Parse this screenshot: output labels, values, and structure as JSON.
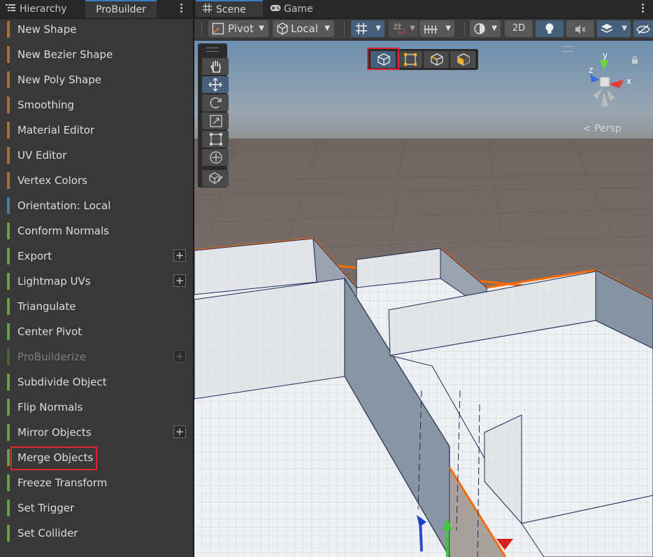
{
  "left_panel": {
    "tabs": [
      {
        "label": "Hierarchy",
        "icon": "hierarchy-icon"
      },
      {
        "label": "ProBuilder"
      }
    ],
    "items": [
      {
        "label": "New Shape",
        "color": "#b06a3b",
        "plus": false,
        "disabled": false
      },
      {
        "label": "New Bezier Shape",
        "color": "#b06a3b",
        "plus": false,
        "disabled": false
      },
      {
        "label": "New Poly Shape",
        "color": "#b06a3b",
        "plus": false,
        "disabled": false
      },
      {
        "label": "Smoothing",
        "color": "#b06a3b",
        "plus": false,
        "disabled": false
      },
      {
        "label": "Material Editor",
        "color": "#b06a3b",
        "plus": false,
        "disabled": false
      },
      {
        "label": "UV Editor",
        "color": "#b06a3b",
        "plus": false,
        "disabled": false
      },
      {
        "label": "Vertex Colors",
        "color": "#b06a3b",
        "plus": false,
        "disabled": false
      },
      {
        "label": "Orientation: Local",
        "color": "#3c7fb5",
        "plus": false,
        "disabled": false
      },
      {
        "label": "Conform Normals",
        "color": "#6aa33a",
        "plus": false,
        "disabled": false
      },
      {
        "label": "Export",
        "color": "#6aa33a",
        "plus": true,
        "disabled": false
      },
      {
        "label": "Lightmap UVs",
        "color": "#6aa33a",
        "plus": true,
        "disabled": false
      },
      {
        "label": "Triangulate",
        "color": "#6aa33a",
        "plus": false,
        "disabled": false
      },
      {
        "label": "Center Pivot",
        "color": "#6aa33a",
        "plus": false,
        "disabled": false
      },
      {
        "label": "ProBuilderize",
        "color": "#4a6136",
        "plus": true,
        "disabled": true
      },
      {
        "label": "Subdivide Object",
        "color": "#6aa33a",
        "plus": false,
        "disabled": false
      },
      {
        "label": "Flip Normals",
        "color": "#6aa33a",
        "plus": false,
        "disabled": false
      },
      {
        "label": "Mirror Objects",
        "color": "#6aa33a",
        "plus": true,
        "disabled": false
      },
      {
        "label": "Merge Objects",
        "color": "#6aa33a",
        "plus": false,
        "disabled": false,
        "highlighted": true
      },
      {
        "label": "Freeze Transform",
        "color": "#6aa33a",
        "plus": false,
        "disabled": false
      },
      {
        "label": "Set Trigger",
        "color": "#6aa33a",
        "plus": false,
        "disabled": false
      },
      {
        "label": "Set Collider",
        "color": "#6aa33a",
        "plus": false,
        "disabled": false
      }
    ],
    "plus_symbol": "+"
  },
  "scene": {
    "tabs": [
      {
        "label": "Scene",
        "icon": "grid-icon"
      },
      {
        "label": "Game",
        "icon": "gamepad-icon"
      }
    ],
    "toolbar": {
      "pivot_label": "Pivot",
      "space_label": "Local",
      "mode_2d_label": "2D"
    },
    "gizmo": {
      "x": "x",
      "y": "y",
      "z": "z",
      "view_label": "< Persp"
    },
    "selection_modes": [
      "object-mode-icon",
      "vertex-mode-icon",
      "edge-mode-icon",
      "face-mode-icon"
    ],
    "tools": [
      "hand-icon",
      "move-icon",
      "rotate-icon",
      "scale-icon",
      "rect-tool-icon",
      "transform-icon",
      "custom-tool-icon"
    ],
    "colors": {
      "selection_outline": "#ff6a00",
      "highlight": "#e0262d",
      "active_tool": "#46607c"
    }
  }
}
